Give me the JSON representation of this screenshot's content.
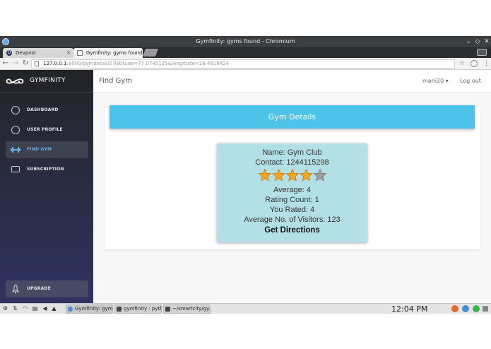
{
  "window": {
    "title": "Gymfinity: gyms found - Chromium"
  },
  "tabs": [
    {
      "label": "Devpost",
      "favicon": "D"
    },
    {
      "label": "Gymfinity: gyms found"
    }
  ],
  "address_bar": {
    "host": "127.0.0.1",
    "path": ":8000/gymdetail/2?latitude=77.0745125&longitude=28.4918424"
  },
  "sidebar": {
    "brand": "GYMFINITY",
    "items": [
      {
        "label": "DASHBOARD",
        "icon": "dashboard-icon"
      },
      {
        "label": "USER PROFILE",
        "icon": "user-icon"
      },
      {
        "label": "FIND GYM",
        "icon": "dumbbell-icon",
        "active": true
      },
      {
        "label": "SUBSCRIPTION",
        "icon": "card-icon"
      }
    ],
    "upgrade": {
      "label": "UPGRADE",
      "icon": "rocket-icon"
    }
  },
  "topbar": {
    "page_title": "Find Gym",
    "user": "mani20 ▾",
    "logout": "Log out"
  },
  "card": {
    "header": "Gym Details"
  },
  "gym": {
    "name": "Name: Gym Club",
    "contact": "Contact: 1244115298",
    "rating": {
      "value": 4,
      "max": 5
    },
    "average": "Average: 4",
    "rating_count": "Rating Count: 1",
    "you_rated": "You Rated: 4",
    "avg_visitors": "Average No. of Visitors: 123",
    "directions": "Get Directions"
  },
  "taskbar": {
    "tasks": [
      {
        "label": "Gymfinity: gym..."
      },
      {
        "label": "gymfinity : pyth..."
      },
      {
        "label": "~/smartcity/gy..."
      }
    ],
    "clock": "12:04 PM"
  },
  "colors": {
    "accent": "#4dc3ea",
    "gym_box": "#b2e0e6",
    "sidebar_active_text": "#63b3ed",
    "star_filled": "#f5a623",
    "star_empty": "#9e9e9e"
  }
}
